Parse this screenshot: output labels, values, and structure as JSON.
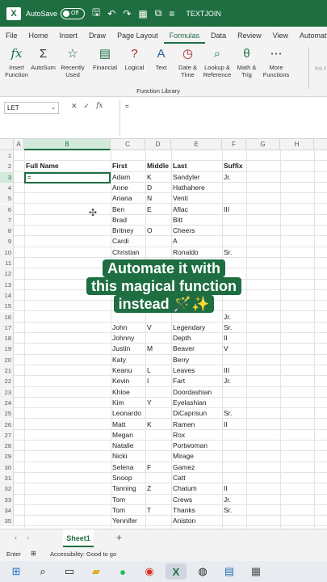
{
  "titlebar": {
    "app_icon": "excel-icon",
    "autosave_label": "AutoSave",
    "autosave_state": "Off",
    "doc_title": "TEXTJOIN",
    "icons": [
      "save-icon",
      "undo-icon",
      "redo-icon",
      "table-icon",
      "format-icon",
      "more-icon"
    ]
  },
  "tabs": [
    "File",
    "Home",
    "Insert",
    "Draw",
    "Page Layout",
    "Formulas",
    "Data",
    "Review",
    "View",
    "Automate"
  ],
  "active_tab": "Formulas",
  "ribbon": {
    "buttons": [
      {
        "label": "Insert Function",
        "icon": "fx-icon"
      },
      {
        "label": "AutoSum",
        "icon": "sigma-icon"
      },
      {
        "label": "Recently Used",
        "icon": "star-icon"
      },
      {
        "label": "Financial",
        "icon": "financial-icon"
      },
      {
        "label": "Logical",
        "icon": "logical-icon"
      },
      {
        "label": "Text",
        "icon": "text-icon"
      },
      {
        "label": "Date & Time",
        "icon": "calendar-icon"
      },
      {
        "label": "Lookup & Reference",
        "icon": "lookup-icon"
      },
      {
        "label": "Math & Trig",
        "icon": "math-icon"
      },
      {
        "label": "More Functions",
        "icon": "more-functions-icon"
      }
    ],
    "group_label": "Function Library",
    "partial_label": "Ins Pyth"
  },
  "formula_bar": {
    "name_box": "LET",
    "cancel": "✕",
    "enter": "✓",
    "fx": "fx",
    "formula": "="
  },
  "columns": [
    "A",
    "B",
    "C",
    "D",
    "E",
    "F",
    "G",
    "H"
  ],
  "headers": {
    "B": "Full Name",
    "C": "First",
    "D": "Middle",
    "E": "Last",
    "F": "Suffix"
  },
  "rows": [
    {
      "n": 1,
      "first": "",
      "middle": "",
      "last": "",
      "suffix": ""
    },
    {
      "n": 2,
      "first": "First",
      "middle": "Middle",
      "last": "Last",
      "suffix": "Suffix"
    },
    {
      "n": 3,
      "first": "Adam",
      "middle": "K",
      "last": "Sandyler",
      "suffix": "Jr."
    },
    {
      "n": 4,
      "first": "Anne",
      "middle": "D",
      "last": "Hathahere",
      "suffix": ""
    },
    {
      "n": 5,
      "first": "Ariana",
      "middle": "N",
      "last": "Venti",
      "suffix": ""
    },
    {
      "n": 6,
      "first": "Ben",
      "middle": "E",
      "last": "Aflac",
      "suffix": "III"
    },
    {
      "n": 7,
      "first": "Brad",
      "middle": "",
      "last": "Bitt",
      "suffix": ""
    },
    {
      "n": 8,
      "first": "Britney",
      "middle": "O",
      "last": "Cheers",
      "suffix": ""
    },
    {
      "n": 9,
      "first": "Cardi",
      "middle": "",
      "last": "A",
      "suffix": ""
    },
    {
      "n": 10,
      "first": "Christian",
      "middle": "",
      "last": "Ronaldo",
      "suffix": "Sr."
    },
    {
      "n": 11,
      "first": "",
      "middle": "",
      "last": "",
      "suffix": ""
    },
    {
      "n": 12,
      "first": "",
      "middle": "",
      "last": "",
      "suffix": ""
    },
    {
      "n": 13,
      "first": "",
      "middle": "",
      "last": "",
      "suffix": ""
    },
    {
      "n": 14,
      "first": "",
      "middle": "",
      "last": "",
      "suffix": ""
    },
    {
      "n": 15,
      "first": "",
      "middle": "",
      "last": "",
      "suffix": ""
    },
    {
      "n": 16,
      "first": "",
      "middle": "",
      "last": "",
      "suffix": "Jr."
    },
    {
      "n": 17,
      "first": "John",
      "middle": "V",
      "last": "Legendary",
      "suffix": "Sr."
    },
    {
      "n": 18,
      "first": "Johnny",
      "middle": "",
      "last": "Depth",
      "suffix": "II"
    },
    {
      "n": 19,
      "first": "Justin",
      "middle": "M",
      "last": "Beaver",
      "suffix": "V"
    },
    {
      "n": 20,
      "first": "Katy",
      "middle": "",
      "last": "Berry",
      "suffix": ""
    },
    {
      "n": 21,
      "first": "Keanu",
      "middle": "L",
      "last": "Leaves",
      "suffix": "III"
    },
    {
      "n": 22,
      "first": "Kevin",
      "middle": "I",
      "last": "Fart",
      "suffix": "Jr."
    },
    {
      "n": 23,
      "first": "Khloe",
      "middle": "",
      "last": "Doordashian",
      "suffix": ""
    },
    {
      "n": 24,
      "first": "Kim",
      "middle": "Y",
      "last": "Eyelashian",
      "suffix": ""
    },
    {
      "n": 25,
      "first": "Leonardo",
      "middle": "",
      "last": "DiCaprisun",
      "suffix": "Sr."
    },
    {
      "n": 26,
      "first": "Matt",
      "middle": "K",
      "last": "Ramen",
      "suffix": "II"
    },
    {
      "n": 27,
      "first": "Megan",
      "middle": "",
      "last": "Rox",
      "suffix": ""
    },
    {
      "n": 28,
      "first": "Natalie",
      "middle": "",
      "last": "Portwoman",
      "suffix": ""
    },
    {
      "n": 29,
      "first": "Nicki",
      "middle": "",
      "last": "Mirage",
      "suffix": ""
    },
    {
      "n": 30,
      "first": "Selena",
      "middle": "F",
      "last": "Gamez",
      "suffix": ""
    },
    {
      "n": 31,
      "first": "Snoop",
      "middle": "",
      "last": "Catt",
      "suffix": ""
    },
    {
      "n": 32,
      "first": "Tanning",
      "middle": "Z",
      "last": "Chatum",
      "suffix": "II"
    },
    {
      "n": 33,
      "first": "Tom",
      "middle": "",
      "last": "Crews",
      "suffix": "Jr."
    },
    {
      "n": 34,
      "first": "Tom",
      "middle": "T",
      "last": "Thanks",
      "suffix": "Sr."
    },
    {
      "n": 35,
      "first": "Yennifer",
      "middle": "",
      "last": "Aniston",
      "suffix": ""
    }
  ],
  "active_cell": {
    "ref": "B3",
    "value": "="
  },
  "overlay": {
    "line1": "Automate it with",
    "line2": "this magical function",
    "line3": "instead 🪄✨"
  },
  "sheet_tabs": {
    "active": "Sheet1",
    "add": "+",
    "prev": "‹",
    "next": "›"
  },
  "status": {
    "mode": "Enter",
    "accessibility": "Accessibility: Good to go"
  },
  "taskbar": [
    "windows-icon",
    "search-icon",
    "task-view-icon",
    "file-explorer-icon",
    "spotify-icon",
    "chrome-icon",
    "excel-icon",
    "obs-icon",
    "notepad-icon",
    "calculator-icon"
  ],
  "colors": {
    "brand": "#1e6e42",
    "ribbon_bg": "#f3f3f3"
  }
}
